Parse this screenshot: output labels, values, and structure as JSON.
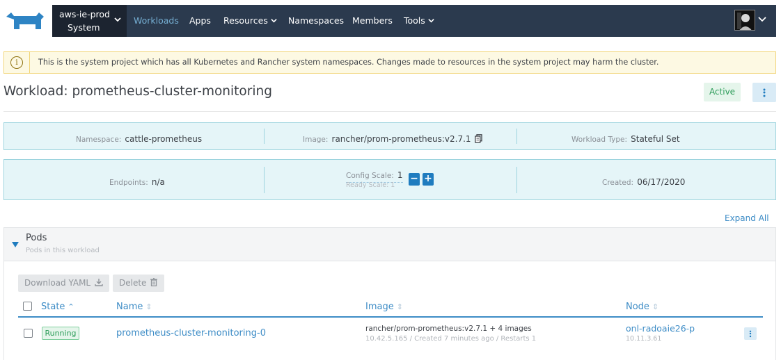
{
  "header": {
    "cluster_name": "aws-ie-prod",
    "project_name": "System",
    "nav": [
      "Workloads",
      "Apps",
      "Resources",
      "Namespaces",
      "Members",
      "Tools"
    ],
    "active_nav": "Workloads",
    "icons": {
      "logo": "rancher-cow-logo",
      "dropdown": "chevron-down-icon",
      "avatar": "user-avatar"
    }
  },
  "banner": {
    "text": "This is the system project which has all Kubernetes and Rancher system namespaces. Changes made to resources in the system project may harm the cluster.",
    "icon": "info-icon"
  },
  "page": {
    "title": "Workload: prometheus-cluster-monitoring",
    "state": "Active"
  },
  "details": {
    "namespace_label": "Namespace:",
    "namespace": "cattle-prometheus",
    "image_label": "Image:",
    "image": "rancher/prom-prometheus:v2.7.1",
    "type_label": "Workload Type:",
    "type": "Stateful Set",
    "endpoints_label": "Endpoints:",
    "endpoints": "n/a",
    "config_scale_label": "Config Scale:",
    "config_scale": "1",
    "ready_scale": "Ready Scale: 1",
    "minus": "−",
    "plus": "+",
    "created_label": "Created:",
    "created": "06/17/2020"
  },
  "pods": {
    "expand_all": "Expand All",
    "title": "Pods",
    "subtitle": "Pods in this workload",
    "download_yaml": "Download YAML",
    "delete": "Delete",
    "columns": {
      "state": "State",
      "name": "Name",
      "image": "Image",
      "node": "Node"
    },
    "rows": [
      {
        "state": "Running",
        "name": "prometheus-cluster-monitoring-0",
        "image": "rancher/prom-prometheus:v2.7.1 + 4 images",
        "image_sub": "10.42.5.165 / Created 7 minutes ago / Restarts 1",
        "node": "onl-radoaie26-p",
        "node_ip": "10.11.3.61"
      }
    ]
  },
  "colors": {
    "nav_bg": "#2b3a4e",
    "accent": "#3d8cc6",
    "active_green": "#2d9c59",
    "info_bg": "#e5f5f8"
  }
}
